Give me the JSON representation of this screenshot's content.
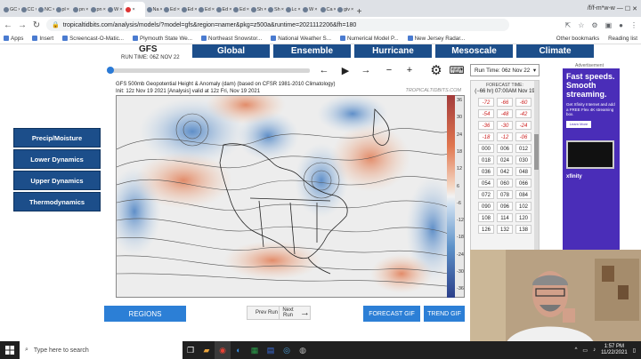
{
  "browser": {
    "tabs": [
      {
        "label": "GC"
      },
      {
        "label": "CC"
      },
      {
        "label": "NC"
      },
      {
        "label": "pl"
      },
      {
        "label": "pn"
      },
      {
        "label": "pn"
      },
      {
        "label": "W"
      },
      {
        "label": "",
        "active": true
      },
      {
        "label": "Na"
      },
      {
        "label": "Ed"
      },
      {
        "label": "Ed"
      },
      {
        "label": "Ed"
      },
      {
        "label": "Ed"
      },
      {
        "label": "Ed"
      },
      {
        "label": "Sh"
      },
      {
        "label": "Sh"
      },
      {
        "label": "Lc"
      },
      {
        "label": "W"
      },
      {
        "label": "Ca"
      },
      {
        "label": "giv"
      }
    ],
    "window_title_fragment": "/f/f-m*w-w",
    "url": "tropicaltidbits.com/analysis/models/?model=gfs&region=namer&pkg=z500a&runtime=2021112206&fh=180"
  },
  "bookmarks": {
    "items": [
      {
        "label": "Apps"
      },
      {
        "label": "Insert"
      },
      {
        "label": "Screencast-O-Matic..."
      },
      {
        "label": "Plymouth State We..."
      },
      {
        "label": "Northeast Snowstor..."
      },
      {
        "label": "National Weather S..."
      },
      {
        "label": "Numerical Model P..."
      },
      {
        "label": "New Jersey Radar..."
      }
    ],
    "other": "Other bookmarks",
    "reading": "Reading list"
  },
  "site": {
    "model_title": "GFS",
    "run_time": "RUN TIME: 06Z NOV 22",
    "nav": [
      "Global",
      "Ensemble",
      "Hurricane",
      "Mesoscale",
      "Climate"
    ],
    "runtime_select": "Run Time: 06z Nov 22"
  },
  "map": {
    "title": "GFS 500mb Geopotential Height & Anomaly (dam) (based on CFSR 1981-2010 Climatology)",
    "subtitle": "Init: 12z Nov 19 2021   [Analysis]   valid at 12z Fri, Nov 19 2021",
    "site_label": "TROPICALTIDBITS.COM",
    "colorbar_ticks": [
      "36",
      "30",
      "24",
      "18",
      "12",
      "6",
      "-6",
      "-12",
      "-18",
      "-24",
      "-30",
      "-36"
    ]
  },
  "left_menu": [
    "Precip/Moisture",
    "Lower Dynamics",
    "Upper Dynamics",
    "Thermodynamics"
  ],
  "forecast_hours": {
    "title": "FORECAST TIME:",
    "current": "(−66 hr) 07:00AM Nov 19",
    "hours": [
      "-72",
      "-66",
      "-60",
      "-54",
      "-48",
      "-42",
      "-36",
      "-30",
      "-24",
      "-18",
      "-12",
      "-06",
      "000",
      "006",
      "012",
      "018",
      "024",
      "030",
      "036",
      "042",
      "048",
      "054",
      "060",
      "066",
      "072",
      "078",
      "084",
      "090",
      "096",
      "102",
      "108",
      "114",
      "120",
      "126",
      "132",
      "138"
    ]
  },
  "ad": {
    "label": "Advertisement",
    "headline": "Fast speeds. Smooth streaming.",
    "body": "Get Xfinity Internet and add a FREE Flex 4K streaming box.",
    "button": "Learn More",
    "logo": "xfinity"
  },
  "bottom_controls": {
    "regions": "REGIONS",
    "prev_run": "Prev Run",
    "next_run": "Next Run",
    "forecast_gif": "FORECAST GIF",
    "trend_gif": "TREND GIF"
  },
  "taskbar": {
    "search_placeholder": "Type here to search",
    "time": "1:57 PM",
    "date": "11/22/2021"
  },
  "colors": {
    "nav_blue": "#1c4e8a",
    "button_blue": "#2c7fd6",
    "ad_purple": "#4a2db8"
  }
}
